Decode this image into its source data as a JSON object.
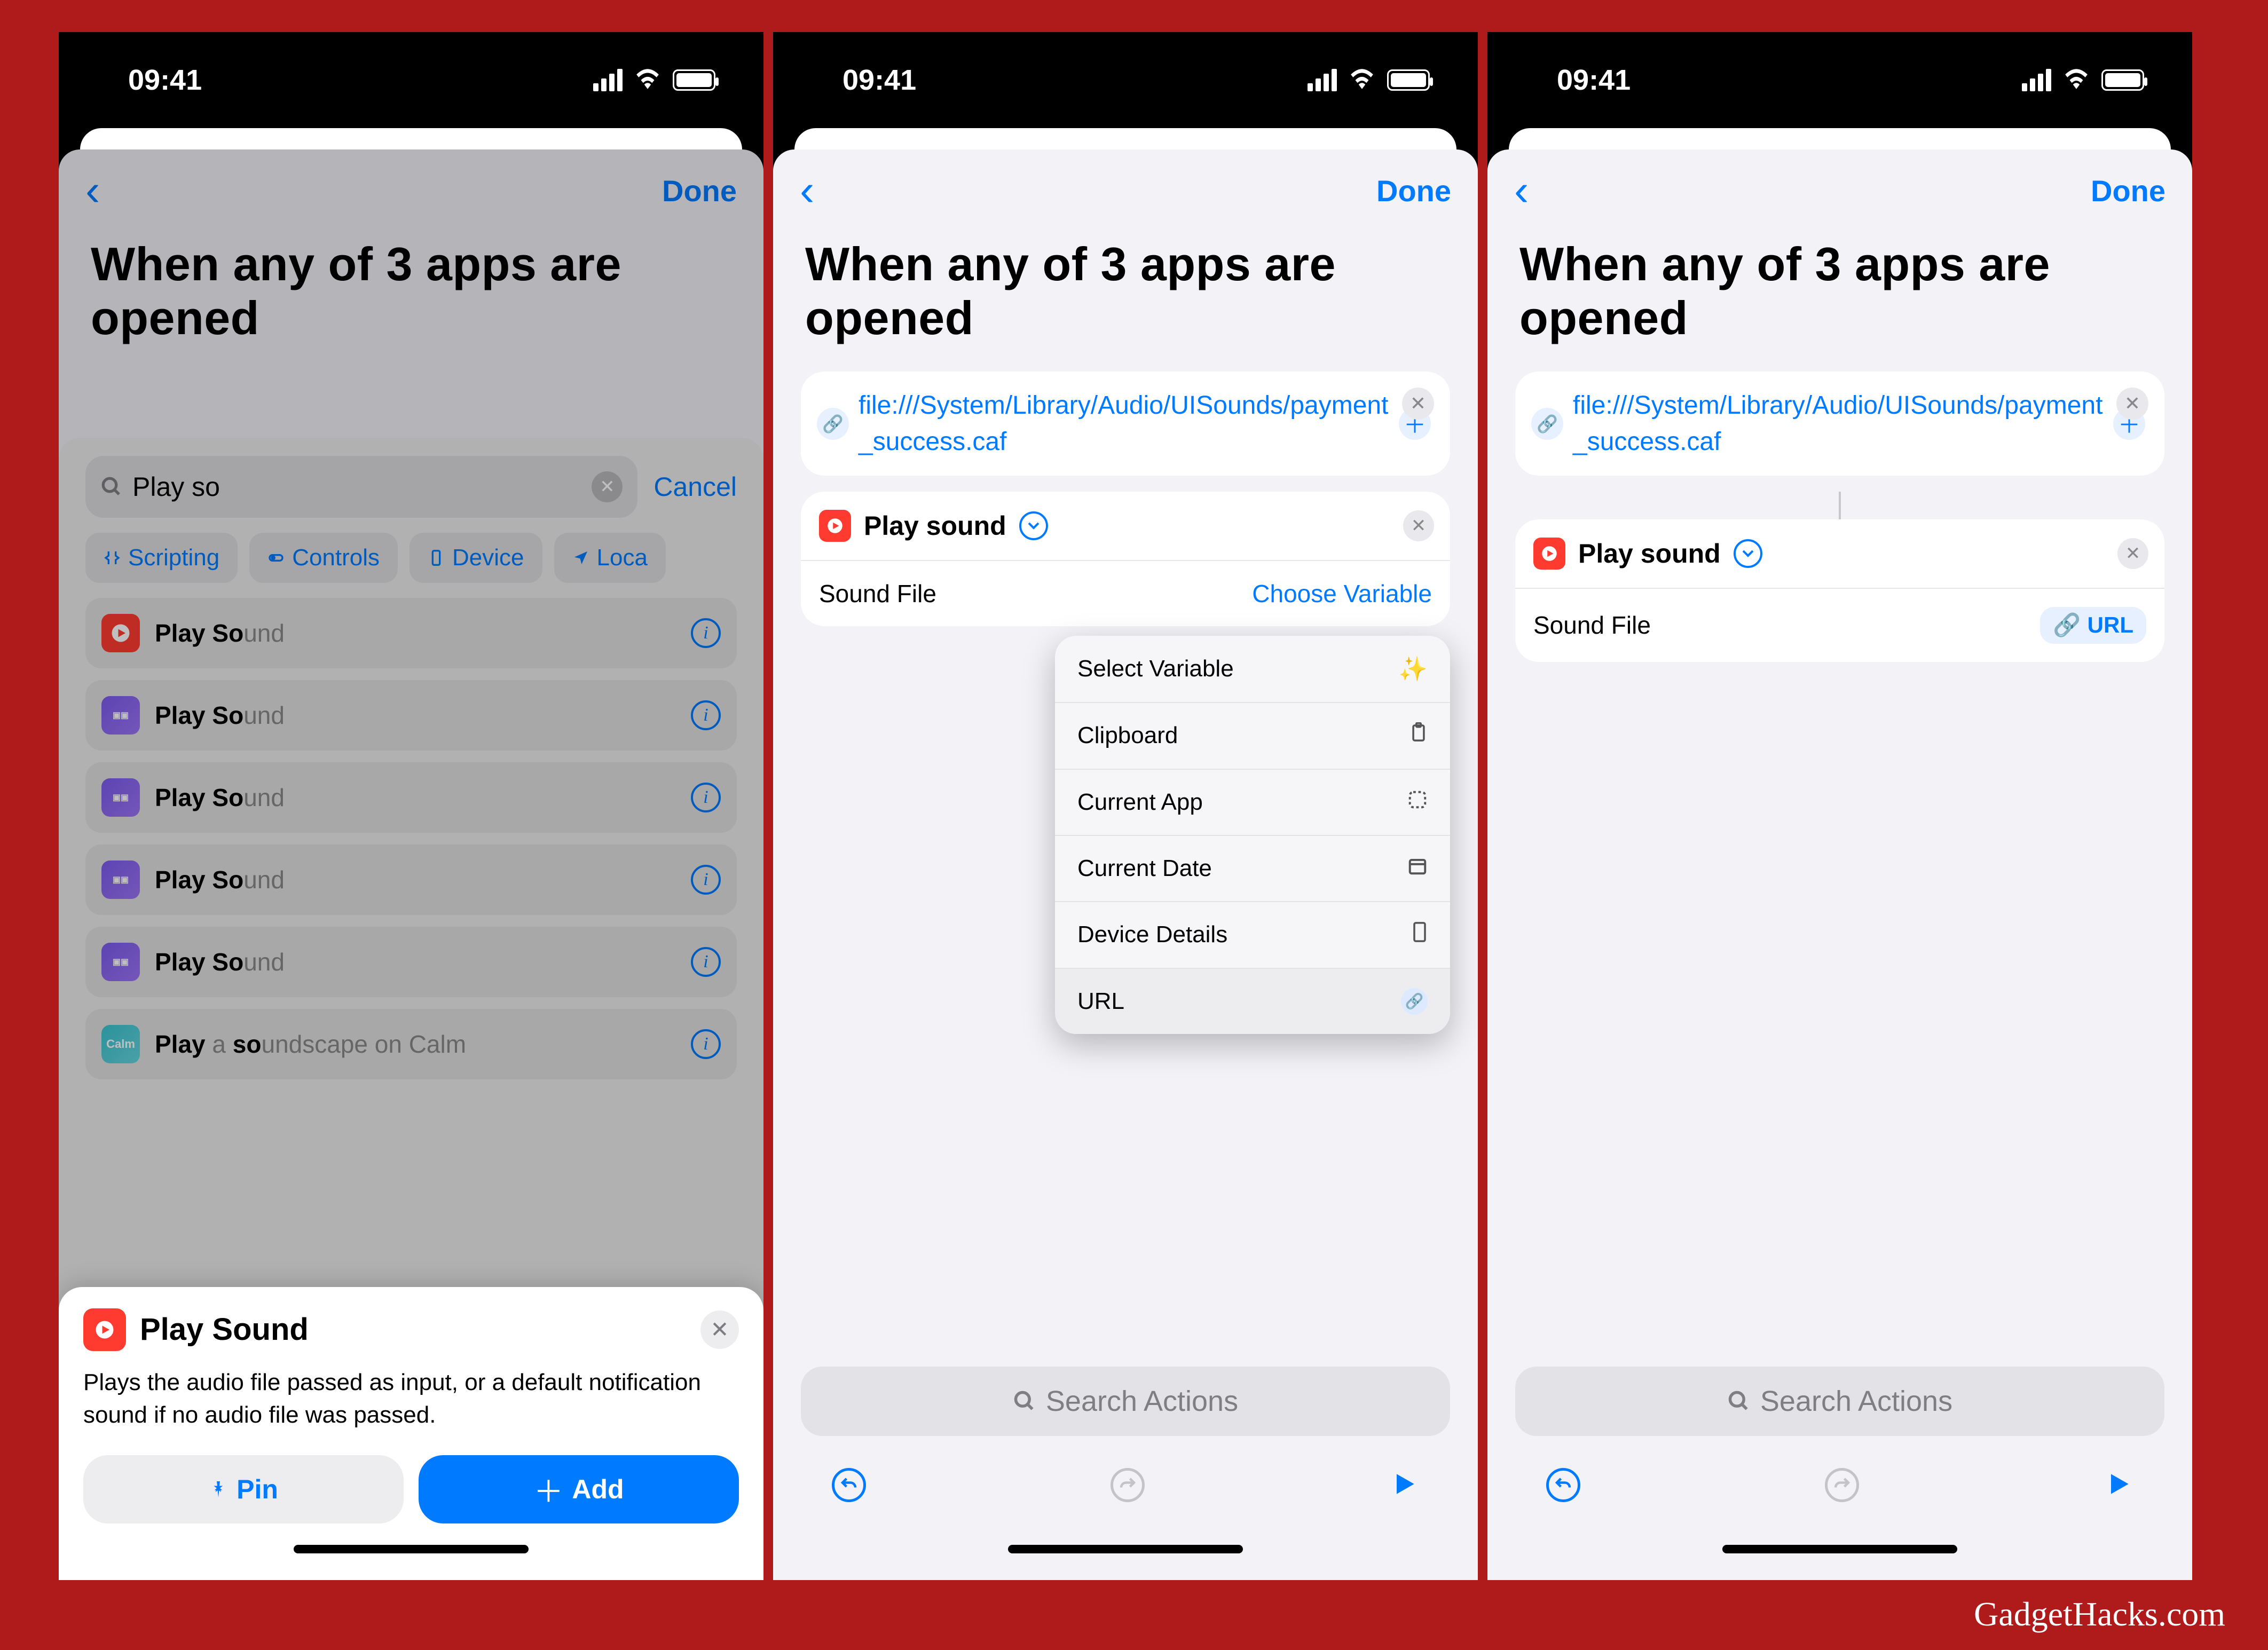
{
  "statusbar": {
    "time": "09:41"
  },
  "sheet": {
    "done": "Done",
    "title": "When any of 3 apps are opened"
  },
  "url_card": {
    "url": "file:///System/Library/Audio/UISounds/payment_success.caf"
  },
  "action": {
    "name": "Play sound",
    "param_label": "Sound File",
    "choose_variable": "Choose Variable",
    "url_pill": "URL"
  },
  "ctx_menu": {
    "select": "Select Variable",
    "clipboard": "Clipboard",
    "current_app": "Current App",
    "current_date": "Current Date",
    "device_details": "Device Details",
    "url": "URL"
  },
  "dock": {
    "search_placeholder": "Search Actions"
  },
  "screen1": {
    "search_text": "Play so",
    "cancel": "Cancel",
    "cats": {
      "c0": "Scripting",
      "c1": "Controls",
      "c2": "Device",
      "c3": "Loca"
    },
    "results": {
      "r0_pre": "Play So",
      "r0_suf": "und",
      "r1_pre": "Play So",
      "r1_suf": "und",
      "r2_pre": "Play So",
      "r2_suf": "und",
      "r3_pre": "Play So",
      "r3_suf": "und",
      "r4_pre": "Play So",
      "r4_suf": "und",
      "r5_pre": "Play",
      "r5_mid": " a ",
      "r5_b": "so",
      "r5_suf": "undscape on Calm"
    },
    "popup": {
      "title": "Play Sound",
      "desc": "Plays the audio file passed as input, or a default notification sound if no audio file was passed.",
      "pin": "Pin",
      "add": "Add"
    }
  },
  "watermark": "GadgetHacks.com"
}
